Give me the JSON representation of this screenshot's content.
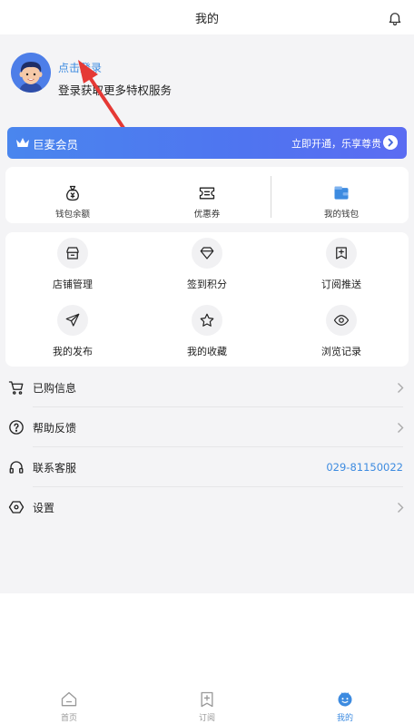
{
  "header": {
    "title": "我的"
  },
  "profile": {
    "login_link": "点击登录",
    "subtitle": "登录获取更多特权服务"
  },
  "vip": {
    "title": "巨麦会员",
    "cta": "立即开通，乐享尊贵"
  },
  "wallet": {
    "items": [
      {
        "label": "钱包余额",
        "icon": "money-bag-icon"
      },
      {
        "label": "优惠券",
        "icon": "coupon-icon"
      },
      {
        "label": "我的钱包",
        "icon": "wallet-icon"
      }
    ]
  },
  "features": {
    "items": [
      {
        "label": "店铺管理",
        "icon": "store-icon"
      },
      {
        "label": "签到积分",
        "icon": "diamond-icon"
      },
      {
        "label": "订阅推送",
        "icon": "subscribe-icon"
      },
      {
        "label": "我的发布",
        "icon": "send-icon"
      },
      {
        "label": "我的收藏",
        "icon": "star-icon"
      },
      {
        "label": "浏览记录",
        "icon": "eye-icon"
      }
    ]
  },
  "list": {
    "purchased": "已购信息",
    "help": "帮助反馈",
    "service": "联系客服",
    "service_phone": "029-81150022",
    "settings": "设置"
  },
  "tabs": [
    {
      "label": "首页",
      "icon": "home-icon"
    },
    {
      "label": "订阅",
      "icon": "subscribe-icon"
    },
    {
      "label": "我的",
      "icon": "profile-icon",
      "active": true
    }
  ],
  "colors": {
    "accent": "#3d8be0",
    "vip_gradient_start": "#4a86ee",
    "vip_gradient_end": "#5b6cf2"
  }
}
